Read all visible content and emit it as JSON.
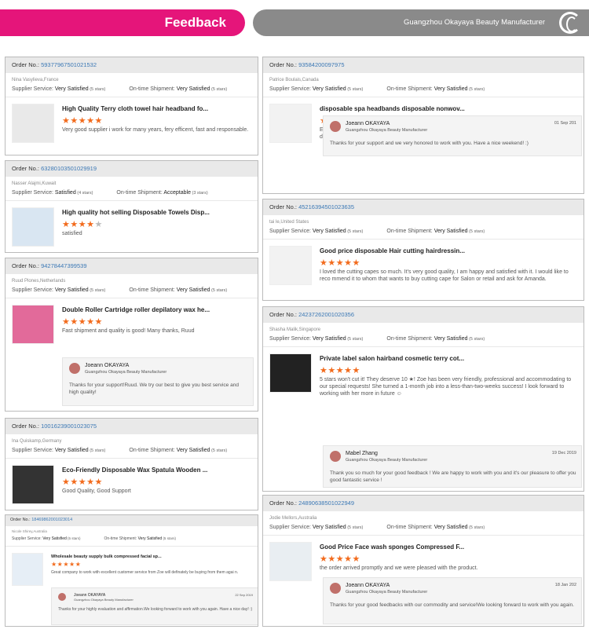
{
  "header": {
    "title": "Feedback",
    "company": "Guangzhou Okayaya Beauty Manufacturer"
  },
  "labels": {
    "order": "Order No.:",
    "supplier": "Supplier Service:",
    "shipment": "On-time Shipment:"
  },
  "colors": {
    "accent": "#e5157a",
    "star": "#f26b1d",
    "link": "#3b78b5"
  },
  "cards": [
    {
      "order": "59377967501021532",
      "customer": "Nina Vasylieva,France",
      "supplier": "Very Satisfied",
      "supplier_stars": "(5 stars)",
      "shipment": "Very Satisfied",
      "shipment_stars": "(5 stars)",
      "product": "High Quality Terry cloth towel hair headband fo...",
      "rating": 5,
      "review": "Very good supplier i work for many years, fery efficent, fast and responsable."
    },
    {
      "order": "93584200097975",
      "customer": "Patrice Boulais,Canada",
      "supplier": "Very Satisfied",
      "supplier_stars": "(5 stars)",
      "shipment": "Very Satisfied",
      "shipment_stars": "(5 stars)",
      "product": "disposable spa headbands disposable nonwov...",
      "rating": 5,
      "review": "Extremely satisfied with the service, the product is as per expectation, the shipping coordination and deliver y were smooth and easy.",
      "reply": {
        "name": "Joeann OKAYAYA",
        "company": "Guangzhou Okayaya Beauty Manufacturer",
        "date": "01 Sep 201",
        "text": "Thanks for your support and we very honored to work with you. Have a nice weekend! :)"
      }
    },
    {
      "order": "63280103501029919",
      "customer": "Nasser Alajmi,Kuwait",
      "supplier": "Satisfied",
      "supplier_stars": "(4 stars)",
      "shipment": "Acceptable",
      "shipment_stars": "(3 stars)",
      "product": "High quality hot selling Disposable Towels Disp...",
      "rating": 4,
      "review": "satisfied"
    },
    {
      "order": "45216394501023635",
      "customer": "tai le,United States",
      "supplier": "Very Satisfied",
      "supplier_stars": "(5 stars)",
      "shipment": "Very Satisfied",
      "shipment_stars": "(5 stars)",
      "product": "Good price disposable Hair cutting hairdressin...",
      "rating": 5,
      "review": "I loved the cutting capes so much. It's very good quality, I am happy and satisfied with it. I would like to reco mmend it to whom that wants to buy cutting cape for Salon or retail and ask for Amanda."
    },
    {
      "order": "94278447399539",
      "customer": "Ruud Plones,Netherlands",
      "supplier": "Very Satisfied",
      "supplier_stars": "(5 stars)",
      "shipment": "Very Satisfied",
      "shipment_stars": "(5 stars)",
      "product": "Double Roller Cartridge roller depilatory wax he...",
      "rating": 5,
      "review": "Fast shipment and quality is good! Many thanks, Ruud",
      "reply": {
        "name": "Joeann OKAYAYA",
        "company": "Guangzhou Okayaya Beauty Manufacturer",
        "date": "",
        "text": "Thanks for your support!Ruud. We try our best to give you best service and high quality!"
      }
    },
    {
      "order": "24237262001020356",
      "customer": "Shasha Malik,Singapore",
      "supplier": "Very Satisfied",
      "supplier_stars": "(5 stars)",
      "shipment": "Very Satisfied",
      "shipment_stars": "(5 stars)",
      "product": "Private label salon hairband cosmetic terry cot...",
      "rating": 5,
      "review": "5 stars won't cut it! They deserve 10 ★! Zoe has been very friendly, professional and accommodating to our special requests! She turned a 1-month job into a less-than-two-weeks success! I look forward to working with her more in future ☺",
      "reply": {
        "name": "Mabel Zhang",
        "company": "Guangzhou Okayaya Beauty Manufacturer",
        "date": "19 Dec 2019",
        "text": "Thank you so much for your good feedback ! We are happy to work with you and it's our pleasure to offer you good fantastic service !"
      }
    },
    {
      "order": "10016239001023075",
      "customer": "Ina Quiskamp,Germany",
      "supplier": "Very Satisfied",
      "supplier_stars": "(5 stars)",
      "shipment": "Very Satisfied",
      "shipment_stars": "(5 stars)",
      "product": "Eco-Friendly Disposable Wax Spatula Wooden ...",
      "rating": 5,
      "review": "Good Quality, Good Support"
    },
    {
      "order": "18469862001023014",
      "customer": "Nicole Shirey,Australia",
      "supplier": "Very Satisfied",
      "supplier_stars": "(5 stars)",
      "shipment": "Very Satisfied",
      "shipment_stars": "(5 stars)",
      "product": "Wholesale beauty supply bulk compressed facial sp...",
      "rating": 5,
      "review": "Great company to work with excellent customer service from Zoe will definately be buying from them agai n.",
      "reply": {
        "name": "Joeann OKAYAYA",
        "company": "Guangzhou Okayaya Beauty Manufacturer",
        "date": "22 Sep 2019",
        "text": "Thanks for your highly evaluation and affirmation.We looking forward to work with you again. Have a nice day! :)"
      }
    },
    {
      "order": "24890638501022949",
      "customer": "Jodie Mellors,Australia",
      "supplier": "Very Satisfied",
      "supplier_stars": "(5 stars)",
      "shipment": "Very Satisfied",
      "shipment_stars": "(5 stars)",
      "product": "Good Price Face wash sponges Compressed F...",
      "rating": 5,
      "review": "the order arrived promptly and we were pleased with the product.",
      "reply": {
        "name": "Joeann OKAYAYA",
        "company": "Guangzhou Okayaya Beauty Manufacturer",
        "date": "18 Jan 202",
        "text": "Thanks for your good feedbacks with our commodity and service!We looking forward to work with you again."
      }
    }
  ]
}
